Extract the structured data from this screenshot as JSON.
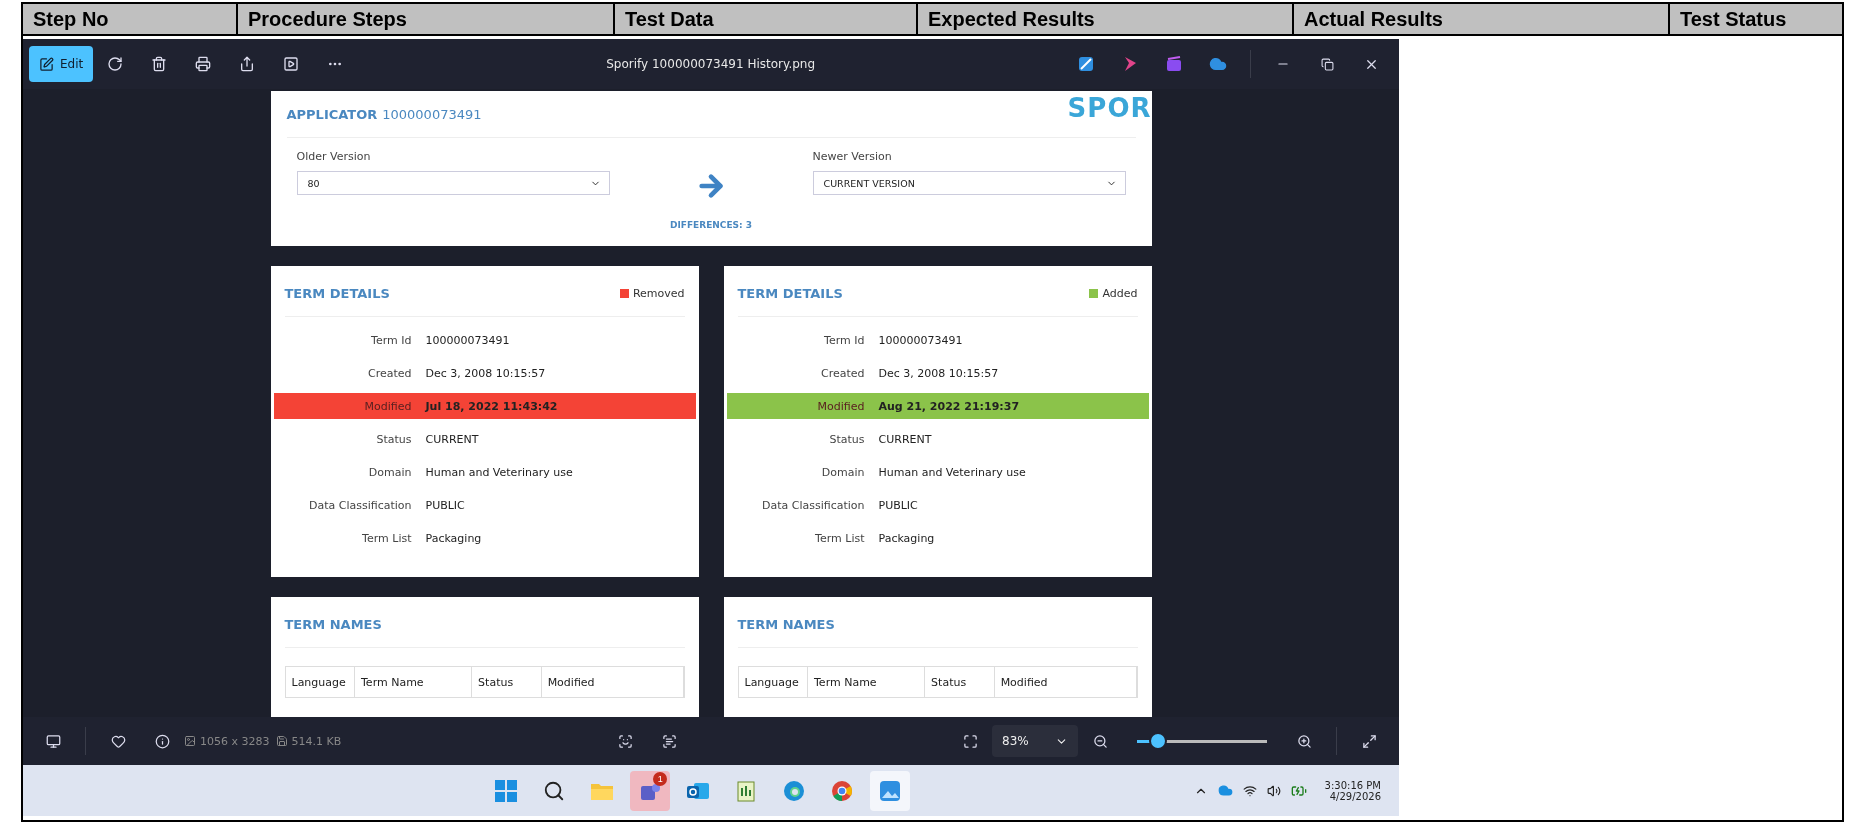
{
  "table": {
    "columns": [
      "Step No",
      "Procedure Steps",
      "Test Data",
      "Expected Results",
      "Actual Results",
      "Test Status"
    ]
  },
  "viewer": {
    "edit_label": "Edit",
    "title": "Sporify 100000073491 History.png",
    "page": {
      "applicator": {
        "label": "APPLICATOR",
        "id": "100000073491"
      },
      "logo": "SPOR",
      "older": {
        "label": "Older Version",
        "value": "80"
      },
      "newer": {
        "label": "Newer Version",
        "value": "CURRENT VERSION"
      },
      "differences": "DIFFERENCES: 3",
      "details": [
        {
          "title": "TERM DETAILS",
          "legend": {
            "label": "Removed",
            "color": "#f44336"
          },
          "rows": [
            {
              "label": "Term Id",
              "value": "100000073491",
              "changed": false
            },
            {
              "label": "Created",
              "value": "Dec 3, 2008 10:15:57",
              "changed": false
            },
            {
              "label": "Modified",
              "value": "Jul 18, 2022 11:43:42",
              "changed": true
            },
            {
              "label": "Status",
              "value": "CURRENT",
              "changed": false
            },
            {
              "label": "Domain",
              "value": "Human and Veterinary use",
              "changed": false
            },
            {
              "label": "Data Classification",
              "value": "PUBLIC",
              "changed": false
            },
            {
              "label": "Term List",
              "value": "Packaging",
              "changed": false
            }
          ]
        },
        {
          "title": "TERM DETAILS",
          "legend": {
            "label": "Added",
            "color": "#8bc34a"
          },
          "rows": [
            {
              "label": "Term Id",
              "value": "100000073491",
              "changed": false
            },
            {
              "label": "Created",
              "value": "Dec 3, 2008 10:15:57",
              "changed": false
            },
            {
              "label": "Modified",
              "value": "Aug 21, 2022 21:19:37",
              "changed": true
            },
            {
              "label": "Status",
              "value": "CURRENT",
              "changed": false
            },
            {
              "label": "Domain",
              "value": "Human and Veterinary use",
              "changed": false
            },
            {
              "label": "Data Classification",
              "value": "PUBLIC",
              "changed": false
            },
            {
              "label": "Term List",
              "value": "Packaging",
              "changed": false
            }
          ]
        }
      ],
      "names": [
        {
          "title": "TERM NAMES",
          "columns": [
            "Language",
            "Term Name",
            "Status",
            "Modified"
          ]
        },
        {
          "title": "TERM NAMES",
          "columns": [
            "Language",
            "Term Name",
            "Status",
            "Modified"
          ]
        }
      ]
    },
    "status_bar": {
      "dimensions": "1056 x 3283",
      "file_size": "514.1 KB",
      "zoom": "83%",
      "zoom_slider": {
        "level": 0.14
      }
    }
  },
  "taskbar": {
    "apps": [
      {
        "kind": "start",
        "selected": false
      },
      {
        "kind": "search",
        "selected": false
      },
      {
        "kind": "folder",
        "selected": false
      },
      {
        "kind": "chat",
        "selected": false,
        "badge": "1"
      },
      {
        "kind": "mail",
        "selected": false
      },
      {
        "kind": "notes",
        "selected": false
      },
      {
        "kind": "edge",
        "selected": false
      },
      {
        "kind": "chrome",
        "selected": false
      },
      {
        "kind": "photos",
        "selected": true
      }
    ],
    "time": "3:30:16 PM",
    "date": "4/29/2026"
  }
}
